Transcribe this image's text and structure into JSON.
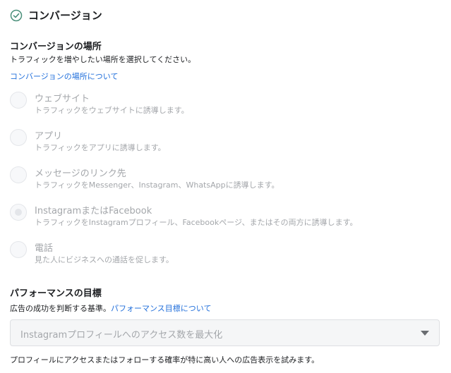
{
  "section": {
    "title": "コンバージョン",
    "icon": "check-circle-icon",
    "accent_color": "#4a8f7a"
  },
  "conversion_location": {
    "title": "コンバージョンの場所",
    "subtitle": "トラフィックを増やしたい場所を選択してください。",
    "link": "コンバージョンの場所について",
    "options": [
      {
        "label": "ウェブサイト",
        "description": "トラフィックをウェブサイトに誘導します。",
        "selected": false
      },
      {
        "label": "アプリ",
        "description": "トラフィックをアプリに誘導します。",
        "selected": false
      },
      {
        "label": "メッセージのリンク先",
        "description": "トラフィックをMessenger、Instagram、WhatsAppに誘導します。",
        "selected": false
      },
      {
        "label": "InstagramまたはFacebook",
        "description": "トラフィックをInstagramプロフィール、Facebookページ、またはその両方に誘導します。",
        "selected": true
      },
      {
        "label": "電話",
        "description": "見た人にビジネスへの通話を促します。",
        "selected": false
      }
    ]
  },
  "performance_goal": {
    "title": "パフォーマンスの目標",
    "subtitle": "広告の成功を判断する基準。",
    "link": "パフォーマンス目標について",
    "dropdown_value": "Instagramプロフィールへのアクセス数を最大化",
    "footnote": "プロフィールにアクセスまたはフォローする確率が特に高い人への広告表示を試みます。"
  },
  "colors": {
    "link": "#216fdb",
    "disabled_text": "#a4a7ab"
  }
}
